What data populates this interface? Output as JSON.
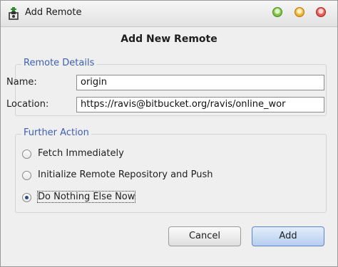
{
  "window": {
    "title": "Add Remote",
    "icon": "git-remote-add-icon",
    "controls": [
      "maximize",
      "minimize",
      "close"
    ],
    "control_colors": {
      "maximize": "#6ab43c",
      "minimize": "#f0b030",
      "close": "#e0524a"
    }
  },
  "dialog": {
    "header": "Add New Remote"
  },
  "remote_details": {
    "legend": "Remote Details",
    "name_label": "Name:",
    "name_value": "origin",
    "location_label": "Location:",
    "location_value": "https://ravis@bitbucket.org/ravis/online_wor"
  },
  "further_action": {
    "legend": "Further Action",
    "options": [
      {
        "label": "Fetch Immediately",
        "checked": false
      },
      {
        "label": "Initialize Remote Repository and Push",
        "checked": false
      },
      {
        "label": "Do Nothing Else Now",
        "checked": true
      }
    ]
  },
  "buttons": {
    "cancel_label": "Cancel",
    "add_label": "Add"
  },
  "colors": {
    "legend_text": "#3e5fb0",
    "default_button": "#b5cdef"
  }
}
